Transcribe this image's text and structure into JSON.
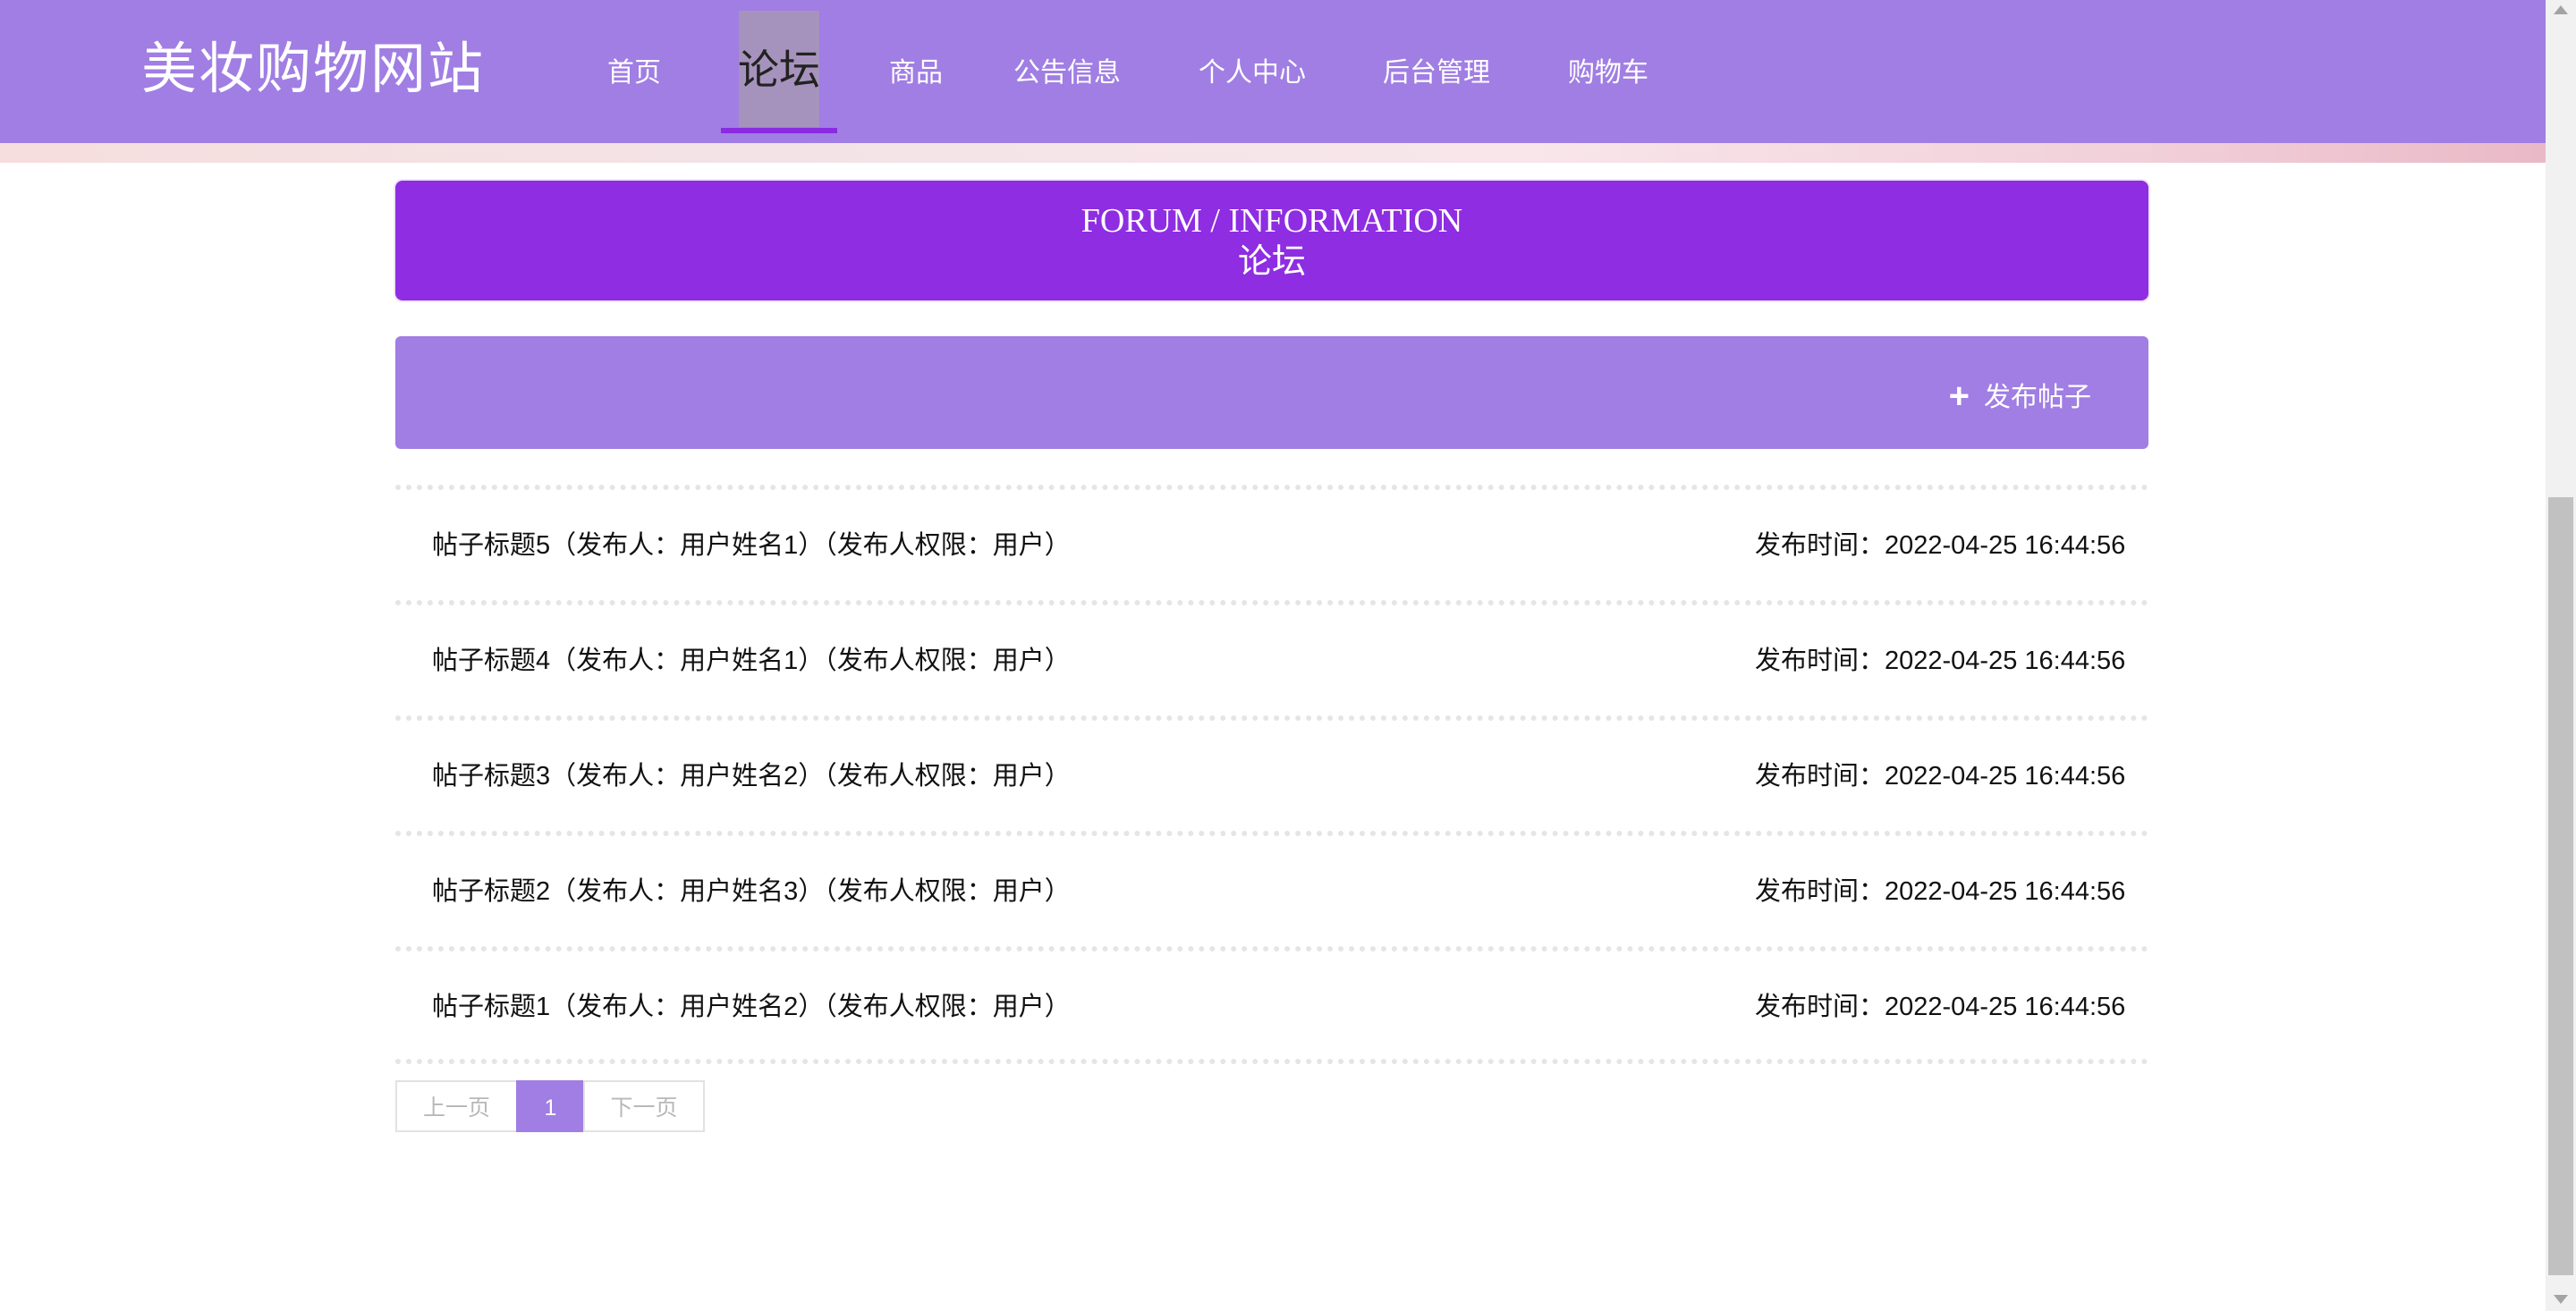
{
  "header": {
    "logo": "美妆购物网站",
    "nav": [
      {
        "label": "首页"
      },
      {
        "label": "论坛",
        "active": true
      },
      {
        "label": "商品"
      },
      {
        "label": "公告信息"
      },
      {
        "label": "个人中心"
      },
      {
        "label": "后台管理"
      },
      {
        "label": "购物车"
      }
    ]
  },
  "banner": {
    "title_en": "FORUM / INFORMATION",
    "title_cn": "论坛"
  },
  "toolbar": {
    "publish_label": "发布帖子",
    "publish_icon": "plus-icon"
  },
  "posts": [
    {
      "title": "帖子标题5（发布人：用户姓名1）（发布人权限：用户）",
      "time": "发布时间：2022-04-25 16:44:56"
    },
    {
      "title": "帖子标题4（发布人：用户姓名1）（发布人权限：用户）",
      "time": "发布时间：2022-04-25 16:44:56"
    },
    {
      "title": "帖子标题3（发布人：用户姓名2）（发布人权限：用户）",
      "time": "发布时间：2022-04-25 16:44:56"
    },
    {
      "title": "帖子标题2（发布人：用户姓名3）（发布人权限：用户）",
      "time": "发布时间：2022-04-25 16:44:56"
    },
    {
      "title": "帖子标题1（发布人：用户姓名2）（发布人权限：用户）",
      "time": "发布时间：2022-04-25 16:44:56"
    }
  ],
  "pagination": {
    "prev_label": "上一页",
    "current": "1",
    "next_label": "下一页"
  },
  "colors": {
    "header": "#a07ee3",
    "banner": "#8e2de2",
    "active_underline": "#8a2be2"
  }
}
